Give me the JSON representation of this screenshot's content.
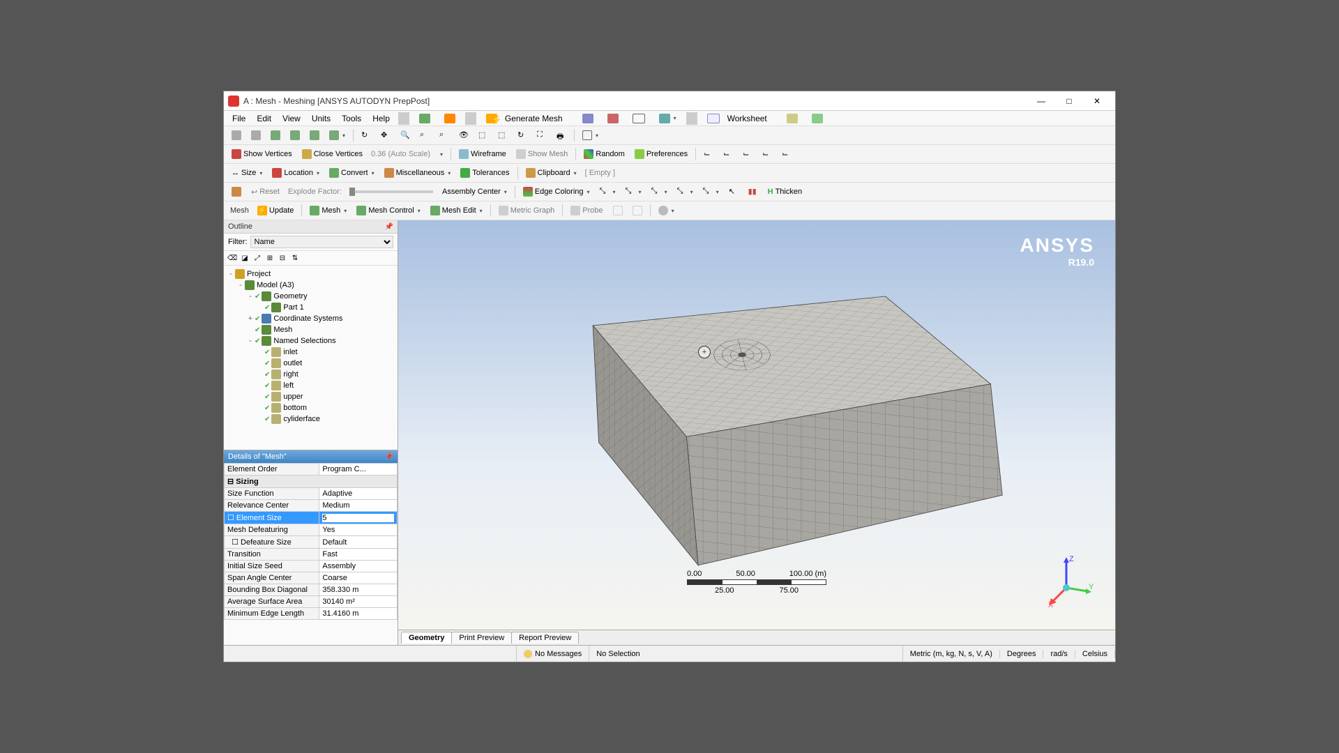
{
  "title": "A : Mesh - Meshing [ANSYS AUTODYN PrepPost]",
  "menu": [
    "File",
    "Edit",
    "View",
    "Units",
    "Tools",
    "Help"
  ],
  "toolbars": {
    "t1": {
      "gen_mesh": "Generate Mesh",
      "worksheet": "Worksheet"
    },
    "t2": {
      "show_vert": "Show Vertices",
      "close_vert": "Close Vertices",
      "scale": "0.36 (Auto Scale)",
      "wireframe": "Wireframe",
      "show_mesh": "Show Mesh",
      "random": "Random",
      "prefs": "Preferences"
    },
    "t3": {
      "size": "Size",
      "location": "Location",
      "convert": "Convert",
      "misc": "Miscellaneous",
      "tol": "Tolerances",
      "clipboard": "Clipboard",
      "empty": "[ Empty ]"
    },
    "t4": {
      "reset": "Reset",
      "explode": "Explode Factor:",
      "assy": "Assembly Center",
      "edge_color": "Edge Coloring",
      "thicken": "Thicken"
    },
    "t5": {
      "mesh": "Mesh",
      "update": "Update",
      "mesh_dd": "Mesh",
      "mesh_ctrl": "Mesh Control",
      "mesh_edit": "Mesh Edit",
      "metric": "Metric Graph",
      "probe": "Probe"
    }
  },
  "outline": {
    "header": "Outline",
    "filter_label": "Filter:",
    "filter_value": "Name",
    "tree": [
      {
        "lvl": 0,
        "exp": "-",
        "icon": "#d0a020",
        "label": "Project"
      },
      {
        "lvl": 1,
        "exp": "-",
        "icon": "#5a8a3a",
        "label": "Model (A3)"
      },
      {
        "lvl": 2,
        "exp": "-",
        "icon": "#5a8a3a",
        "check": true,
        "label": "Geometry"
      },
      {
        "lvl": 3,
        "exp": "",
        "icon": "#5a8a3a",
        "check": true,
        "label": "Part 1"
      },
      {
        "lvl": 2,
        "exp": "+",
        "icon": "#4a7ab0",
        "check": true,
        "label": "Coordinate Systems"
      },
      {
        "lvl": 2,
        "exp": "",
        "icon": "#5a8a3a",
        "check": true,
        "label": "Mesh"
      },
      {
        "lvl": 2,
        "exp": "-",
        "icon": "#5a8a3a",
        "check": true,
        "label": "Named Selections"
      },
      {
        "lvl": 3,
        "exp": "",
        "icon": "#b8b070",
        "check": true,
        "label": "inlet"
      },
      {
        "lvl": 3,
        "exp": "",
        "icon": "#b8b070",
        "check": true,
        "label": "outlet"
      },
      {
        "lvl": 3,
        "exp": "",
        "icon": "#b8b070",
        "check": true,
        "label": "right"
      },
      {
        "lvl": 3,
        "exp": "",
        "icon": "#b8b070",
        "check": true,
        "label": "left"
      },
      {
        "lvl": 3,
        "exp": "",
        "icon": "#b8b070",
        "check": true,
        "label": "upper"
      },
      {
        "lvl": 3,
        "exp": "",
        "icon": "#b8b070",
        "check": true,
        "label": "bottom"
      },
      {
        "lvl": 3,
        "exp": "",
        "icon": "#b8b070",
        "check": true,
        "label": "cyliderface"
      }
    ]
  },
  "details": {
    "header": "Details of \"Mesh\"",
    "rows": [
      {
        "k": "Element Order",
        "v": "Program C..."
      },
      {
        "group": "Sizing"
      },
      {
        "k": "Size Function",
        "v": "Adaptive"
      },
      {
        "k": "Relevance Center",
        "v": "Medium"
      },
      {
        "k": "Element Size",
        "v": "5",
        "selected": true,
        "editable": true
      },
      {
        "k": "Mesh Defeaturing",
        "v": "Yes"
      },
      {
        "k": "Defeature Size",
        "v": "Default",
        "indent": true
      },
      {
        "k": "Transition",
        "v": "Fast"
      },
      {
        "k": "Initial Size Seed",
        "v": "Assembly"
      },
      {
        "k": "Span Angle Center",
        "v": "Coarse"
      },
      {
        "k": "Bounding Box Diagonal",
        "v": "358.330 m"
      },
      {
        "k": "Average Surface Area",
        "v": "30140 m²"
      },
      {
        "k": "Minimum Edge Length",
        "v": "31.4160 m"
      }
    ]
  },
  "viewport": {
    "brand": "ANSYS",
    "version": "R19.0",
    "ruler": {
      "top": [
        "0.00",
        "50.00",
        "100.00 (m)"
      ],
      "bottom": [
        "25.00",
        "75.00"
      ]
    },
    "triad": {
      "x": "X",
      "y": "Y",
      "z": "Z"
    }
  },
  "bottom_tabs": [
    "Geometry",
    "Print Preview",
    "Report Preview"
  ],
  "status": {
    "messages": "No Messages",
    "selection": "No Selection",
    "units": "Metric (m, kg, N, s, V, A)",
    "angle": "Degrees",
    "rot": "rad/s",
    "temp": "Celsius"
  }
}
